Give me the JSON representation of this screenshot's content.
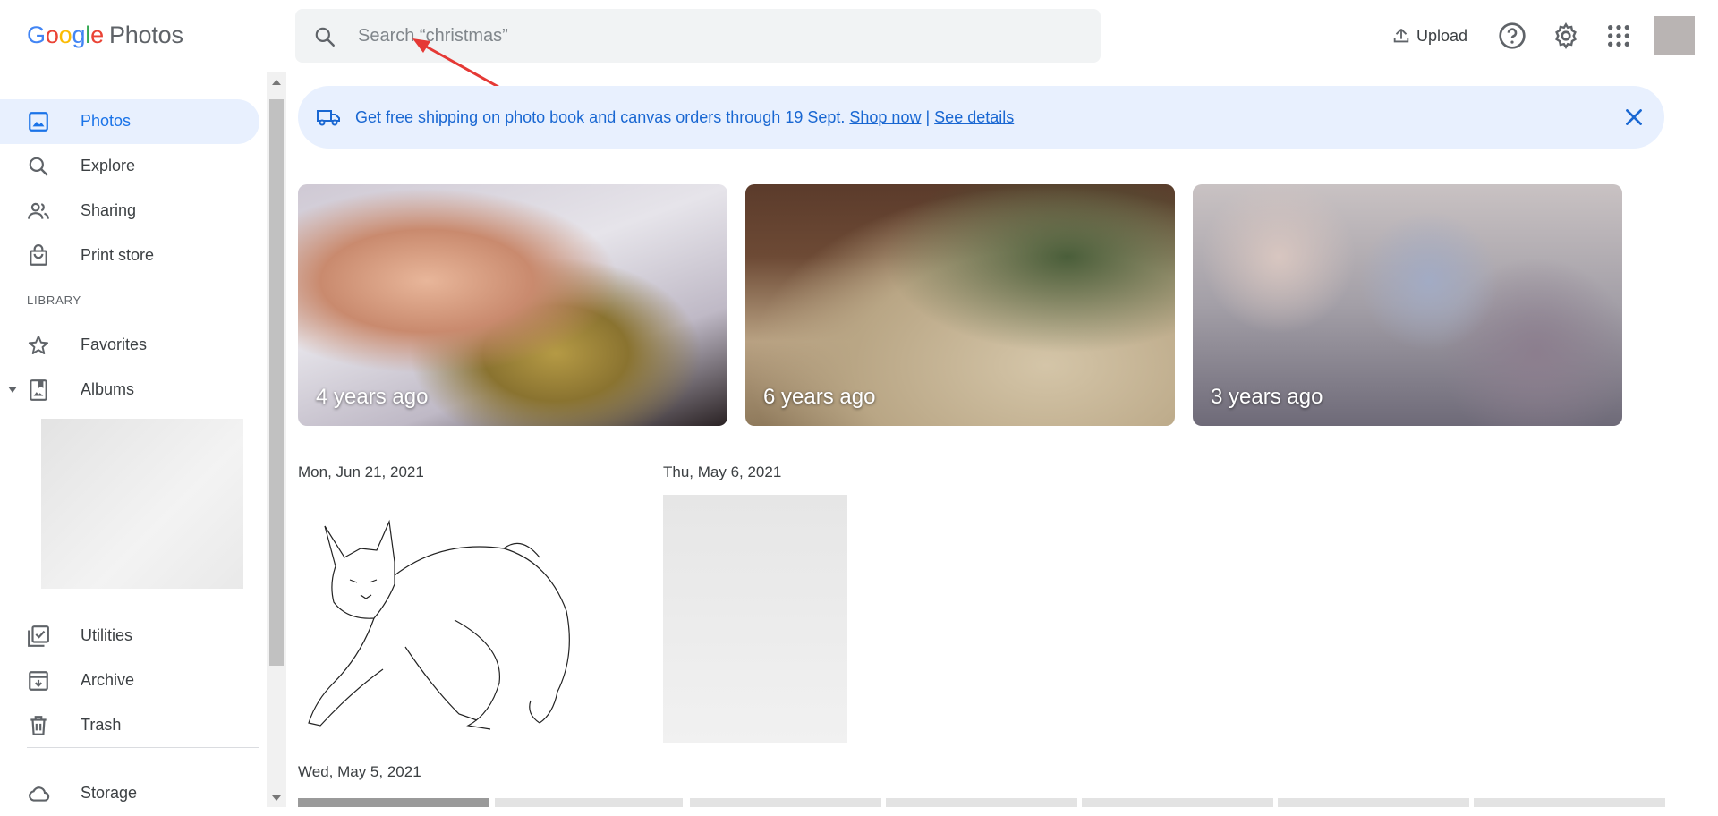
{
  "header": {
    "logo_letters": [
      "G",
      "o",
      "o",
      "g",
      "l",
      "e"
    ],
    "logo_colors": [
      "#4285F4",
      "#EA4335",
      "#FBBC05",
      "#4285F4",
      "#34A853",
      "#EA4335"
    ],
    "logo_suffix": "Photos",
    "search_placeholder": "Search “christmas”",
    "upload_label": "Upload",
    "icons": [
      "upload-icon",
      "help-icon",
      "settings-icon",
      "apps-icon"
    ]
  },
  "sidebar": {
    "items": [
      {
        "label": "Photos",
        "icon": "photos-icon",
        "active": true
      },
      {
        "label": "Explore",
        "icon": "search-icon"
      },
      {
        "label": "Sharing",
        "icon": "people-icon"
      },
      {
        "label": "Print store",
        "icon": "shopping-bag-icon"
      }
    ],
    "library_label": "LIBRARY",
    "library_items": [
      {
        "label": "Favorites",
        "icon": "star-icon"
      },
      {
        "label": "Albums",
        "icon": "album-icon"
      }
    ],
    "bottom_items": [
      {
        "label": "Utilities",
        "icon": "utilities-icon"
      },
      {
        "label": "Archive",
        "icon": "archive-icon"
      },
      {
        "label": "Trash",
        "icon": "trash-icon"
      }
    ],
    "storage_label": "Storage"
  },
  "banner": {
    "text": "Get free shipping on photo book and canvas orders through 19 Sept.",
    "shop_link": "Shop now",
    "separator": "|",
    "details_link": "See details",
    "color": "#1967d2"
  },
  "memories": [
    {
      "caption": "4 years ago"
    },
    {
      "caption": "6 years ago"
    },
    {
      "caption": "3 years ago"
    }
  ],
  "dates": [
    "Mon, Jun 21, 2021",
    "Thu, May 6, 2021",
    "Wed, May 5, 2021"
  ],
  "accent": "#1a73e8"
}
